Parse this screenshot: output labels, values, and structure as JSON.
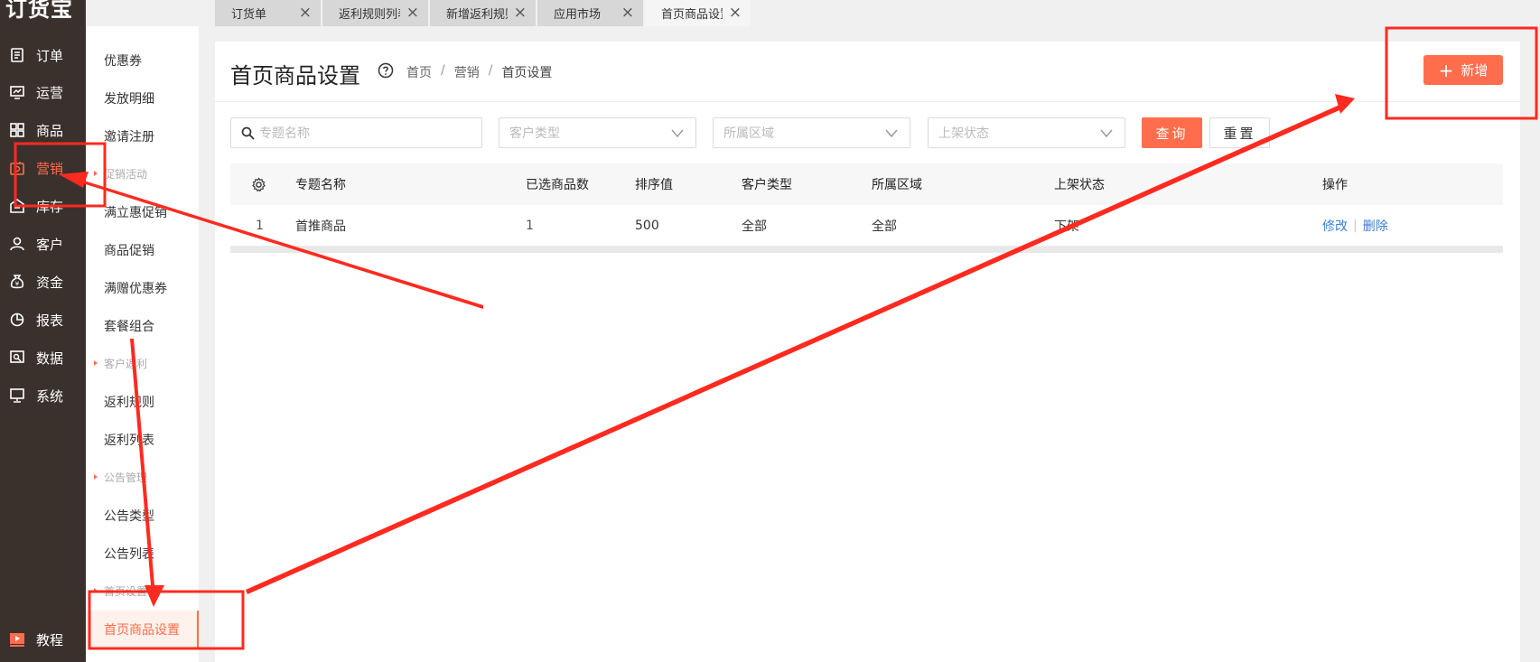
{
  "app": {
    "logo": "订货宝"
  },
  "leftnav": {
    "items": [
      {
        "label": "订单",
        "icon": "order-icon"
      },
      {
        "label": "运营",
        "icon": "operations-icon"
      },
      {
        "label": "商品",
        "icon": "goods-icon"
      },
      {
        "label": "营销",
        "icon": "marketing-icon",
        "active": true
      },
      {
        "label": "库存",
        "icon": "inventory-icon"
      },
      {
        "label": "客户",
        "icon": "customer-icon"
      },
      {
        "label": "资金",
        "icon": "funds-icon"
      },
      {
        "label": "报表",
        "icon": "report-icon"
      },
      {
        "label": "数据",
        "icon": "data-icon"
      },
      {
        "label": "系统",
        "icon": "system-icon"
      }
    ],
    "tutorial": "教程"
  },
  "subnav": {
    "items": [
      "优惠券",
      "发放明细",
      "邀请注册"
    ],
    "group_promo": "促销活动",
    "promo_items": [
      "满立惠促销",
      "商品促销",
      "满赠优惠券",
      "套餐组合"
    ],
    "group_rebate": "客户返利",
    "rebate_items": [
      "返利规则",
      "返利列表"
    ],
    "group_notice": "公告管理",
    "notice_items": [
      "公告类型",
      "公告列表"
    ],
    "group_home": "首页设置",
    "home_items": [
      "首页商品设置"
    ],
    "active": "首页商品设置"
  },
  "tabs": [
    {
      "label": "订货单"
    },
    {
      "label": "返利规则列表"
    },
    {
      "label": "新增返利规则"
    },
    {
      "label": "应用市场"
    },
    {
      "label": "首页商品设置",
      "active": true
    }
  ],
  "header": {
    "title": "首页商品设置",
    "breadcrumb": [
      "首页",
      "营销",
      "首页设置"
    ],
    "add_button": "新增"
  },
  "filters": {
    "topic_placeholder": "专题名称",
    "customer_type_placeholder": "客户类型",
    "region_placeholder": "所属区域",
    "status_placeholder": "上架状态",
    "query_button": "查询",
    "reset_button": "重置"
  },
  "table": {
    "columns": [
      "专题名称",
      "已选商品数",
      "排序值",
      "客户类型",
      "所属区域",
      "上架状态",
      "操作"
    ],
    "rows": [
      {
        "index": "1",
        "topic": "首推商品",
        "count": "1",
        "sort": "500",
        "customer_type": "全部",
        "region": "全部",
        "status": "下架",
        "edit": "修改",
        "delete": "删除"
      }
    ]
  },
  "colors": {
    "accent": "#ff6d4d",
    "annotation": "#ff2a1f",
    "nav_bg": "#3a312d",
    "link": "#3a7fd5"
  }
}
